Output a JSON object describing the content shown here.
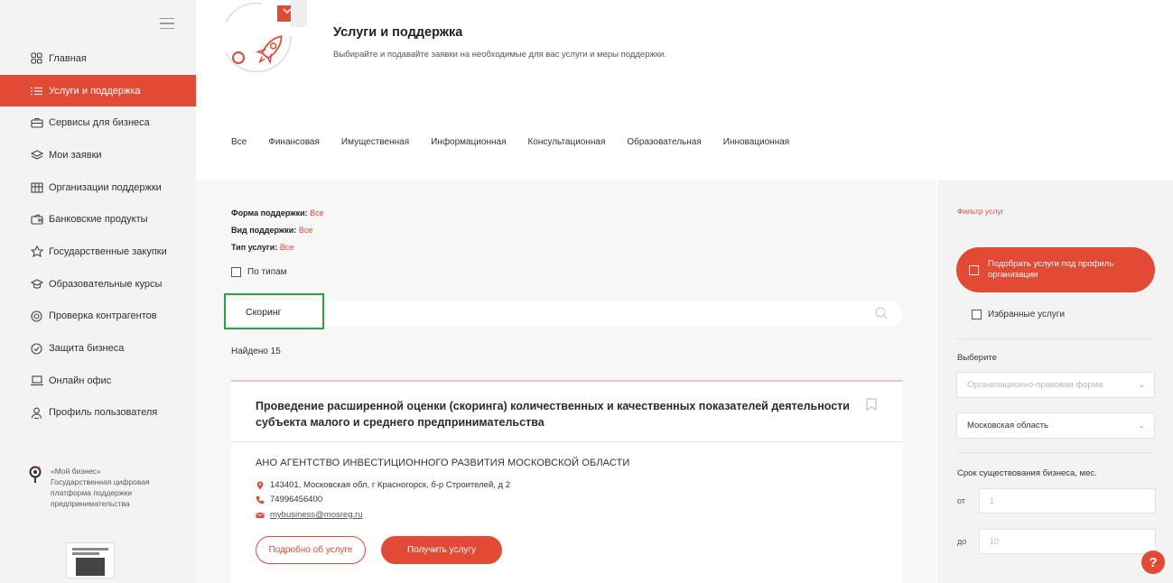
{
  "sidebar": {
    "items": [
      {
        "label": "Главная",
        "icon": "grid-icon",
        "active": false
      },
      {
        "label": "Услуги и поддержка",
        "icon": "list-icon",
        "active": true
      },
      {
        "label": "Сервисы для бизнеса",
        "icon": "briefcase-icon",
        "active": false
      },
      {
        "label": "Мои заявки",
        "icon": "layers-icon",
        "active": false
      },
      {
        "label": "Организации поддержки",
        "icon": "building-icon",
        "active": false
      },
      {
        "label": "Банковские продукты",
        "icon": "wallet-icon",
        "active": false
      },
      {
        "label": "Государственные закупки",
        "icon": "emblem-icon",
        "active": false
      },
      {
        "label": "Образовательные курсы",
        "icon": "graduation-icon",
        "active": false
      },
      {
        "label": "Проверка контрагентов",
        "icon": "check-circle-icon",
        "active": false
      },
      {
        "label": "Защита бизнеса",
        "icon": "shield-icon",
        "active": false
      },
      {
        "label": "Онлайн офис",
        "icon": "laptop-icon",
        "active": false
      },
      {
        "label": "Профиль пользователя",
        "icon": "user-icon",
        "active": false
      }
    ],
    "brand": {
      "line1": "«Мой бизнес»",
      "line2": "Государственная цифровая",
      "line3": "платформа поддержки",
      "line4": "предпринимательства"
    }
  },
  "header": {
    "title": "Услуги и поддержка",
    "subtitle": "Выбирайте и подавайте заявки на необходимые для вас услуги и меры поддержки."
  },
  "tabs": [
    "Все",
    "Финансовая",
    "Имущественная",
    "Информационная",
    "Консультационная",
    "Образовательная",
    "Инновационная"
  ],
  "filters": {
    "form_label": "Форма поддержки:",
    "form_value": "Все",
    "kind_label": "Вид поддержки:",
    "kind_value": "Все",
    "type_label": "Тип услуги:",
    "type_value": "Все",
    "by_types": "По типам"
  },
  "search": {
    "value": "Скоринг"
  },
  "results": {
    "found": "Найдено 15"
  },
  "card": {
    "title": "Проведение расширенной оценки (скоринга) количественных и качественных показателей деятельности субъекта малого и среднего предпринимательства",
    "org": "АНО АГЕНТСТВО ИНВЕСТИЦИОННОГО РАЗВИТИЯ МОСКОВСКОЙ ОБЛАСТИ",
    "address": "143401, Московская обл, г Красногорск, б-р Строителей, д 2",
    "phone": "74996456400",
    "email": "mybusiness@mosreg.ru",
    "details_btn": "Подробно об услуге",
    "get_btn": "Получить услугу"
  },
  "right_panel": {
    "title": "Фильтр услуг",
    "profile_btn": "Подобрать услуги под профиль организации",
    "favorites": "Избранные услуги",
    "choose_label": "Выберите",
    "org_form_placeholder": "Организационно-правовая форма",
    "region_value": "Московская область",
    "term_label": "Срок существования бизнеса, мес.",
    "from_label": "от",
    "from_placeholder": "1",
    "to_label": "до",
    "to_placeholder": "10"
  },
  "help": "?",
  "colors": {
    "accent": "#e34a35",
    "search_highlight": "#2aa24a"
  }
}
